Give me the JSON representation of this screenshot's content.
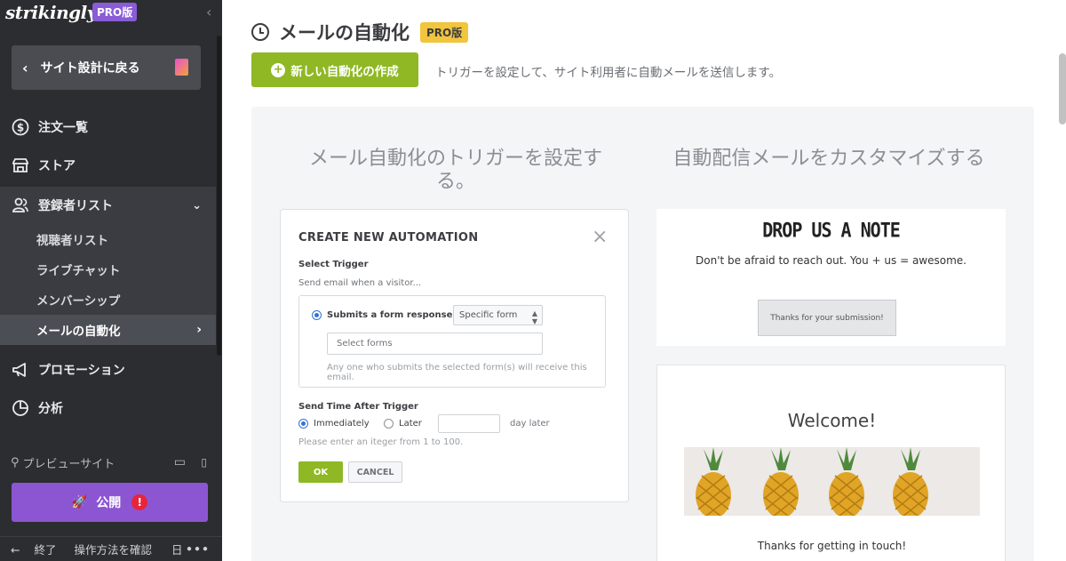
{
  "sidebar": {
    "logo": "strikingly",
    "pro_badge": "PRO版",
    "back_label": "サイト設計に戻る",
    "nav": [
      {
        "label": "注文一覧",
        "icon": "dollar-icon"
      },
      {
        "label": "ストア",
        "icon": "store-icon"
      },
      {
        "label": "登録者リスト",
        "icon": "users-icon"
      }
    ],
    "subnav": [
      "視聴者リスト",
      "ライブチャット",
      "メンバーシップ",
      "メールの自動化"
    ],
    "nav_more": [
      {
        "label": "プロモーション",
        "icon": "megaphone-icon"
      },
      {
        "label": "分析",
        "icon": "pie-chart-icon"
      }
    ],
    "preview_label": "プレビューサイト",
    "publish_label": "公開",
    "publish_alert": "!",
    "bottom": {
      "exit": "終了",
      "help": "操作方法を確認",
      "lang": "日",
      "more": "•••"
    }
  },
  "main": {
    "title": "メールの自動化",
    "pro_badge": "PRO版",
    "create_label": "新しい自動化の作成",
    "create_desc": "トリガーを設定して、サイト利用者に自動メールを送信します。",
    "left_heading": "メール自動化のトリガーを設定する。",
    "right_heading": "自動配信メールをカスタマイズする"
  },
  "modal": {
    "title": "CREATE NEW AUTOMATION",
    "select_trigger": "Select Trigger",
    "trigger_hint": "Send email when a visitor...",
    "submits_label": "Submits a form response to",
    "form_select": "Specific form",
    "forms_placeholder": "Select forms",
    "forms_note": "Any one who submits the selected form(s) will receive this email.",
    "send_time_label": "Send Time After Trigger",
    "immediately": "Immediately",
    "later": "Later",
    "day_later": "day later",
    "integer_hint": "Please enter an iteger  from 1 to 100.",
    "ok": "OK",
    "cancel": "CANCEL"
  },
  "preview": {
    "drop_title": "DROP US A NOTE",
    "drop_sub": "Don't be afraid to reach out. You + us = awesome.",
    "thanks_button": "Thanks for your submission!",
    "welcome": "Welcome!",
    "touch": "Thanks for getting in touch!"
  },
  "colors": {
    "sidebar": "#2c2d30",
    "accent_green": "#8fb824",
    "purple": "#8c56d2",
    "pro_yellow": "#f1c53d"
  }
}
